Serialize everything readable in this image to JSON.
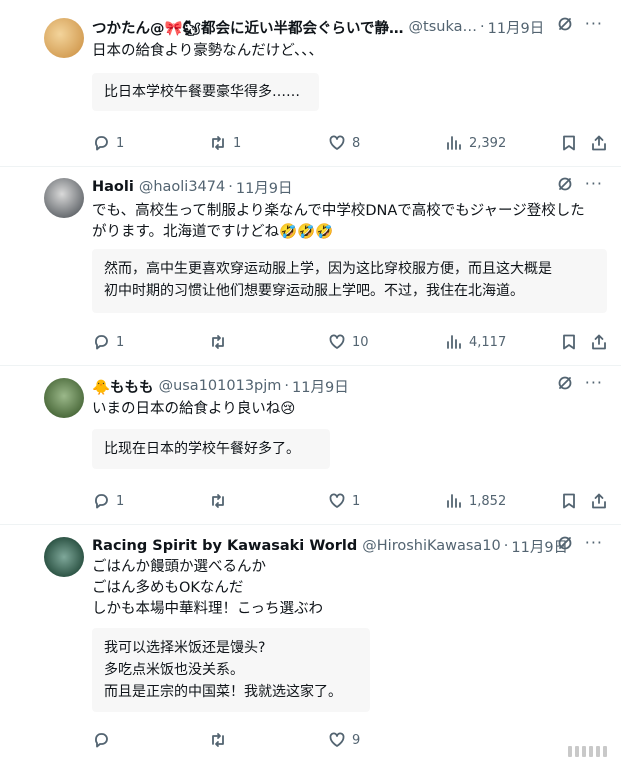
{
  "tweets": [
    {
      "name": "つかたん@🎀🐿都会に近い半都会ぐらいで静…",
      "handle": "@tsuka…",
      "date": "11月9日",
      "text": [
        "日本の給食より豪勢なんだけど、、、"
      ],
      "translation": [
        "比日本学校午餐要豪华得多……"
      ],
      "stats": {
        "replies": "1",
        "reposts": "1",
        "likes": "8",
        "views": "2,392"
      },
      "avatar_color": "#e8b468"
    },
    {
      "name": "Haoli",
      "handle": "@haoli3474",
      "date": "11月9日",
      "text": [
        "でも、高校生って制服より楽なんで中学校DNAで高校でもジャージ登校した",
        "がります。北海道ですけどね🤣🤣🤣"
      ],
      "translation": [
        "然而，高中生更喜欢穿运动服上学，因为这比穿校服方便，而且这大概是",
        "初中时期的习惯让他们想要穿运动服上学吧。不过，我住在北海道。"
      ],
      "stats": {
        "replies": "1",
        "reposts": "",
        "likes": "10",
        "views": "4,117"
      },
      "avatar_color": "#8a8f95"
    },
    {
      "name": "🐥ももも",
      "handle": "@usa101013pjm",
      "date": "11月9日",
      "text": [
        "いまの日本の給食より良いね😢"
      ],
      "translation": [
        "比现在日本的学校午餐好多了。"
      ],
      "stats": {
        "replies": "1",
        "reposts": "",
        "likes": "1",
        "views": "1,852"
      },
      "avatar_color": "#6c8b5a"
    },
    {
      "name": "Racing Spirit by Kawasaki World",
      "handle": "@HiroshiKawasa10",
      "date": "11月9日",
      "text": [
        "ごはんか饅頭か選べるんか",
        "ごはん多めもOKなんだ",
        "しかも本場中華料理！こっち選ぶわ"
      ],
      "translation": [
        "我可以选择米饭还是馒头?",
        "多吃点米饭也没关系。",
        "而且是正宗的中国菜！我就选这家了。"
      ],
      "stats": {
        "replies": "",
        "reposts": "",
        "likes": "9",
        "views": ""
      },
      "avatar_color": "#3d6a5a"
    }
  ],
  "colors": {
    "text": "#0f1419",
    "secondary": "#536471",
    "quote_bg": "#f7f7f7"
  },
  "icons": [
    "reply-icon",
    "repost-icon",
    "like-icon",
    "views-icon",
    "bookmark-icon",
    "share-icon",
    "grok-icon",
    "more-icon"
  ]
}
